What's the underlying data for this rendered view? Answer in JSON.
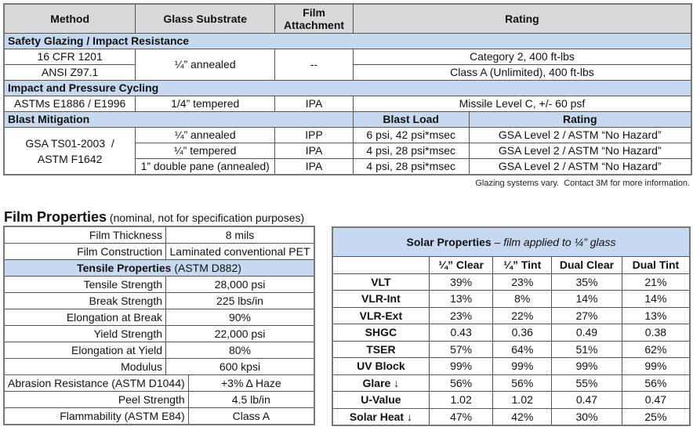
{
  "glazing_table": {
    "headers": [
      "Method",
      "Glass Substrate",
      "Film Attachment",
      "Rating"
    ],
    "sections": [
      {
        "title": "Safety Glazing / Impact Resistance",
        "methods": [
          "16 CFR 1201",
          "ANSI Z97.1"
        ],
        "substrate": "¼” annealed",
        "attachment": "--",
        "ratings": [
          "Category 2, 400 ft-lbs",
          "Class A (Unlimited), 400 ft-lbs"
        ]
      },
      {
        "title": "Impact and Pressure Cycling",
        "method": "ASTMs E1886 / E1996",
        "substrate": "1/4” tempered",
        "attachment": "IPA",
        "rating": "Missile Level C, +/- 60 psf"
      },
      {
        "title": "Blast Mitigation",
        "sub_headers": [
          "Blast Load",
          "Rating"
        ],
        "method_line1": "GSA TS01-2003  /",
        "method_line2": "ASTM F1642",
        "rows": [
          {
            "substrate": "¼” annealed",
            "attachment": "IPP",
            "load": "6 psi, 42 psi*msec",
            "rating": "GSA Level 2 / ASTM “No Hazard”"
          },
          {
            "substrate": "¼” tempered",
            "attachment": "IPA",
            "load": "4 psi, 28 psi*msec",
            "rating": "GSA Level 2 / ASTM “No Hazard”"
          },
          {
            "substrate": "1” double pane (annealed)",
            "attachment": "IPA",
            "load": "4 psi, 28 psi*msec",
            "rating": "GSA Level 2 / ASTM “No Hazard”"
          }
        ]
      }
    ],
    "note": "Glazing systems vary.  Contact 3M for more information."
  },
  "film_properties": {
    "heading": "Film Properties",
    "subheading": " (nominal, not for specification purposes)",
    "rows_top": [
      {
        "label": "Film Thickness",
        "value": "8 mils"
      },
      {
        "label": "Film Construction",
        "value": "Laminated conventional PET"
      }
    ],
    "tensile_title": "Tensile Properties",
    "tensile_sub": " (ASTM D882)",
    "tensile_rows": [
      {
        "label": "Tensile Strength",
        "value": "28,000 psi"
      },
      {
        "label": "Break Strength",
        "value": "225 lbs/in"
      },
      {
        "label": "Elongation at Break",
        "value": "90%"
      },
      {
        "label": "Yield Strength",
        "value": "22,000 psi"
      },
      {
        "label": "Elongation at Yield",
        "value": "80%"
      },
      {
        "label": "Modulus",
        "value": "600 kpsi"
      }
    ],
    "other_rows": [
      {
        "label": "Abrasion Resistance (ASTM D1044)",
        "value": "+3% Δ Haze"
      },
      {
        "label": "Peel Strength",
        "value": "4.5 lb/in"
      },
      {
        "label": "Flammability (ASTM E84)",
        "value": "Class A"
      }
    ]
  },
  "solar_properties": {
    "title": "Solar Properties",
    "subtitle": " – film applied to ¼” glass",
    "columns": [
      "¼” Clear",
      "¼” Tint",
      "Dual Clear",
      "Dual Tint"
    ],
    "rows": [
      {
        "label": "VLT",
        "values": [
          "39%",
          "23%",
          "35%",
          "21%"
        ]
      },
      {
        "label": "VLR-Int",
        "values": [
          "13%",
          "8%",
          "14%",
          "14%"
        ]
      },
      {
        "label": "VLR-Ext",
        "values": [
          "23%",
          "22%",
          "27%",
          "13%"
        ]
      },
      {
        "label": "SHGC",
        "values": [
          "0.43",
          "0.36",
          "0.49",
          "0.38"
        ]
      },
      {
        "label": "TSER",
        "values": [
          "57%",
          "64%",
          "51%",
          "62%"
        ]
      },
      {
        "label": "UV Block",
        "values": [
          "99%",
          "99%",
          "99%",
          "99%"
        ]
      },
      {
        "label": "Glare ↓",
        "values": [
          "56%",
          "56%",
          "55%",
          "56%"
        ]
      },
      {
        "label": "U-Value",
        "values": [
          "1.02",
          "1.02",
          "0.47",
          "0.47"
        ]
      },
      {
        "label": "Solar Heat ↓",
        "values": [
          "47%",
          "42%",
          "30%",
          "25%"
        ]
      }
    ]
  }
}
